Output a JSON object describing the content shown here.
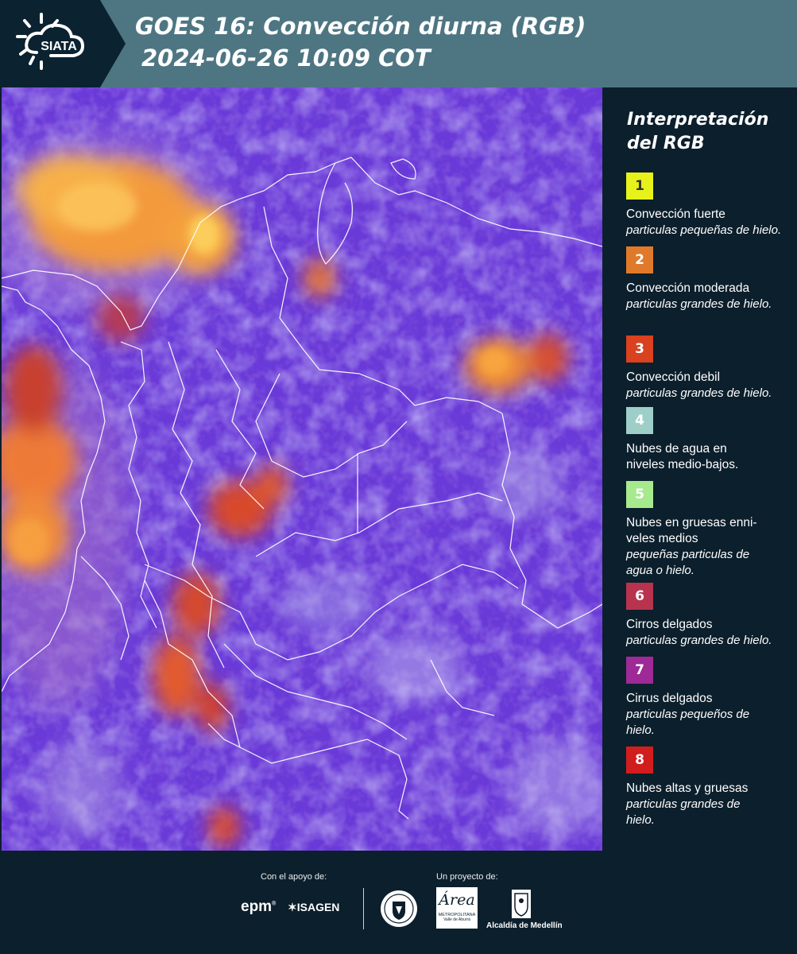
{
  "header": {
    "logo_text": "SIATA",
    "title_line1": "GOES 16: Convección diurna (RGB)",
    "title_line2": "2024-06-26 10:09 COT"
  },
  "legend": {
    "title_line1": "Interpretación",
    "title_line2": "del RGB",
    "items": [
      {
        "number": "1",
        "color": "#e7f21a",
        "text_color": "#333333",
        "label": "Convección fuerte",
        "desc": "particulas pequeñas de hielo."
      },
      {
        "number": "2",
        "color": "#e07a2a",
        "text_color": "#ffffff",
        "label": "Convección moderada",
        "desc": "particulas grandes de hielo."
      },
      {
        "number": "3",
        "color": "#d9411f",
        "text_color": "#ffffff",
        "label": "Convección debil",
        "desc": "particulas grandes de hielo."
      },
      {
        "number": "4",
        "color": "#9dcfc8",
        "text_color": "#ffffff",
        "label": "Nubes de agua en niveles medio-bajos.",
        "desc": ""
      },
      {
        "number": "5",
        "color": "#a7ea8e",
        "text_color": "#ffffff",
        "label": "Nubes en gruesas enni-veles medios",
        "desc": "pequeñas particulas de agua o hielo."
      },
      {
        "number": "6",
        "color": "#b8334e",
        "text_color": "#ffffff",
        "label": "Cirros delgados",
        "desc": "particulas grandes de hielo."
      },
      {
        "number": "7",
        "color": "#9e2a98",
        "text_color": "#ffffff",
        "label": "Cirrus delgados",
        "desc": "particulas pequeños de hielo."
      },
      {
        "number": "8",
        "color": "#d21d1d",
        "text_color": "#ffffff",
        "label": "Nubes altas y gruesas",
        "desc": "particulas grandes de hielo."
      }
    ]
  },
  "footer": {
    "support_caption": "Con el apoyo de:",
    "project_caption": "Un proyecto de:",
    "epm": "epm",
    "isagen": "ISAGEN",
    "area_name": "Área",
    "area_sub1": "METROPOLITANA",
    "area_sub2": "Valle de Aburrá",
    "alcaldia": "Alcaldía de Medellín"
  },
  "colors": {
    "header_bg": "#4e7682",
    "logo_bg": "#0b2330",
    "panel_bg": "#0c1f2c",
    "map_base": "#6b3dd6"
  }
}
